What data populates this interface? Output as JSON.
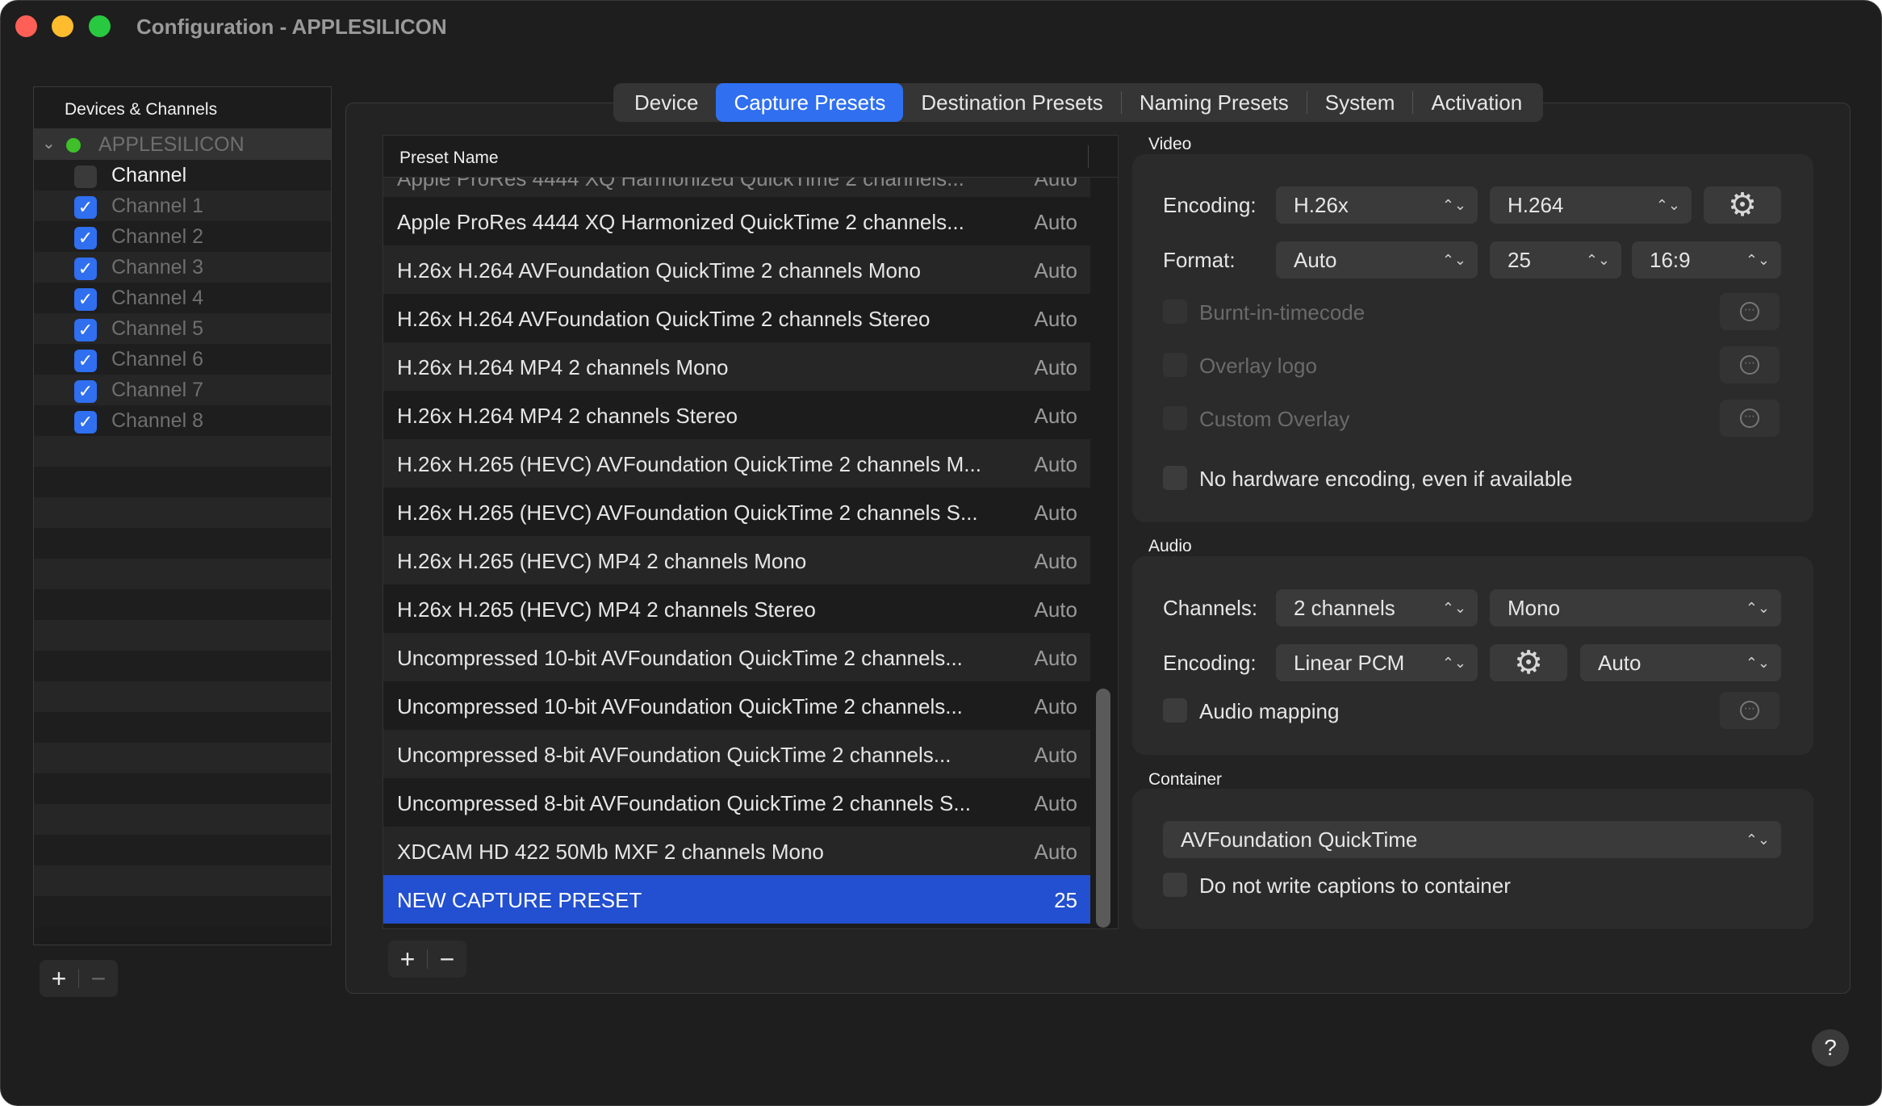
{
  "window": {
    "title": "Configuration - APPLESILICON"
  },
  "sidebar": {
    "header": "Devices & Channels",
    "device": {
      "name": "APPLESILICON",
      "status": "connected"
    },
    "header_checkbox_label": "Channel",
    "channels": [
      {
        "label": "Channel 1",
        "checked": true
      },
      {
        "label": "Channel 2",
        "checked": true
      },
      {
        "label": "Channel 3",
        "checked": true
      },
      {
        "label": "Channel 4",
        "checked": true
      },
      {
        "label": "Channel 5",
        "checked": true
      },
      {
        "label": "Channel 6",
        "checked": true
      },
      {
        "label": "Channel 7",
        "checked": true
      },
      {
        "label": "Channel 8",
        "checked": true
      }
    ],
    "add_label": "+",
    "remove_label": "−"
  },
  "tabs": [
    {
      "label": "Device",
      "active": false
    },
    {
      "label": "Capture Presets",
      "active": true
    },
    {
      "label": "Destination Presets",
      "active": false
    },
    {
      "label": "Naming Presets",
      "active": false
    },
    {
      "label": "System",
      "active": false
    },
    {
      "label": "Activation",
      "active": false
    }
  ],
  "presets": {
    "column_header": "Preset Name",
    "partial_row": {
      "name": "Apple ProRes 4444 XQ Harmonized QuickTime 2 channels...",
      "value": "Auto"
    },
    "rows": [
      {
        "name": "Apple ProRes 4444 XQ Harmonized QuickTime 2 channels...",
        "value": "Auto"
      },
      {
        "name": "H.26x H.264 AVFoundation QuickTime 2 channels Mono",
        "value": "Auto"
      },
      {
        "name": "H.26x H.264 AVFoundation QuickTime 2 channels Stereo",
        "value": "Auto"
      },
      {
        "name": "H.26x H.264 MP4 2 channels Mono",
        "value": "Auto"
      },
      {
        "name": "H.26x H.264 MP4 2 channels Stereo",
        "value": "Auto"
      },
      {
        "name": "H.26x H.265 (HEVC) AVFoundation QuickTime 2 channels M...",
        "value": "Auto"
      },
      {
        "name": "H.26x H.265 (HEVC) AVFoundation QuickTime 2 channels S...",
        "value": "Auto"
      },
      {
        "name": "H.26x H.265 (HEVC) MP4 2 channels Mono",
        "value": "Auto"
      },
      {
        "name": "H.26x H.265 (HEVC) MP4 2 channels Stereo",
        "value": "Auto"
      },
      {
        "name": "Uncompressed 10-bit AVFoundation QuickTime 2 channels...",
        "value": "Auto"
      },
      {
        "name": "Uncompressed 10-bit AVFoundation QuickTime 2 channels...",
        "value": "Auto"
      },
      {
        "name": "Uncompressed 8-bit AVFoundation QuickTime 2 channels...",
        "value": "Auto"
      },
      {
        "name": "Uncompressed 8-bit AVFoundation QuickTime 2 channels S...",
        "value": "Auto"
      },
      {
        "name": "XDCAM HD 422 50Mb MXF 2 channels Mono",
        "value": "Auto"
      },
      {
        "name": "NEW CAPTURE PRESET",
        "value": "25",
        "selected": true
      }
    ],
    "add_label": "+",
    "remove_label": "−"
  },
  "video": {
    "title": "Video",
    "encoding_label": "Encoding:",
    "encoding_family": "H.26x",
    "encoding_codec": "H.264",
    "format_label": "Format:",
    "format_value": "Auto",
    "frame_rate": "25",
    "aspect_ratio": "16:9",
    "burnt_in_label": "Burnt-in-timecode",
    "overlay_logo_label": "Overlay logo",
    "custom_overlay_label": "Custom Overlay",
    "no_hw_label": "No hardware encoding, even if available"
  },
  "audio": {
    "title": "Audio",
    "channels_label": "Channels:",
    "channels_value": "2 channels",
    "channels_mode": "Mono",
    "encoding_label": "Encoding:",
    "encoding_value": "Linear PCM",
    "rate_value": "Auto",
    "mapping_label": "Audio mapping"
  },
  "container": {
    "title": "Container",
    "format_value": "AVFoundation QuickTime",
    "no_captions_label": "Do not write captions to container"
  },
  "help_label": "?",
  "icons": {
    "popup_arrows": "⌃⌄",
    "gear": "⚙",
    "more": "⋯",
    "check": "✓",
    "chevron": "⌄"
  },
  "colors": {
    "accent": "#2f6ff0",
    "selection": "#2350d0",
    "status_green": "#3fbf2a",
    "window_bg": "#1e1e1e"
  }
}
